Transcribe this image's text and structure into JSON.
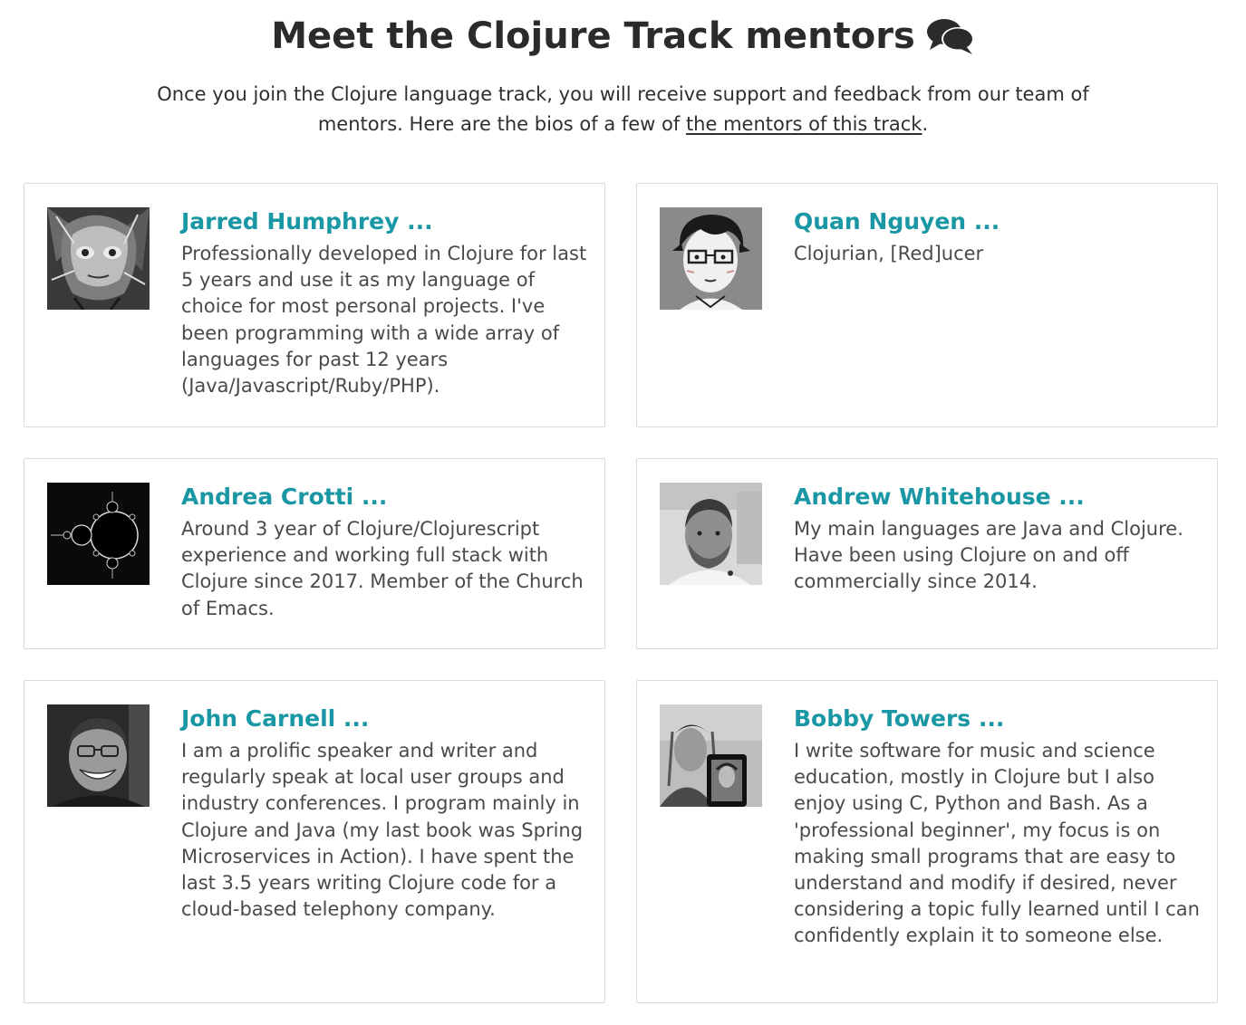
{
  "header": {
    "title": "Meet the Clojure Track mentors",
    "title_icon": "comments-icon",
    "intro_text": "Once you join the Clojure language track, you will receive support and feedback from our team of mentors. Here are the bios of a few of ",
    "intro_link": "the mentors of this track",
    "intro_end": "."
  },
  "colors": {
    "accent": "#1a97a4",
    "text": "#4a4a4a",
    "border": "#dadada"
  },
  "mentors": [
    {
      "name": "Jarred Humphrey ...",
      "avatar": "illustrated-face-avatar",
      "bio": "Professionally developed in Clojure for last 5 years and use it as my language of choice for most personal projects. I've been programming with a wide array of languages for past 12 years (Java/Javascript/Ruby/PHP)."
    },
    {
      "name": "Quan Nguyen ...",
      "avatar": "cartoon-glasses-avatar",
      "bio": "Clojurian, [Red]ucer"
    },
    {
      "name": "Andrea Crotti ...",
      "avatar": "mandelbrot-fractal-avatar",
      "bio": "Around 3 year of Clojure/Clojurescript experience and working full stack with Clojure since 2017. Member of the Church of Emacs."
    },
    {
      "name": "Andrew Whitehouse ...",
      "avatar": "bearded-man-photo-avatar",
      "bio": "My main languages are Java and Clojure. Have been using Clojure on and off commercially since 2014."
    },
    {
      "name": "John Carnell ...",
      "avatar": "smiling-man-photo-avatar",
      "bio": "I am a prolific speaker and writer and regularly speak at local user groups and industry conferences. I program mainly in Clojure and Java (my last book was Spring Microservices in Action). I have spent the last 3.5 years writing Clojure code for a cloud-based telephony company."
    },
    {
      "name": "Bobby Towers ...",
      "avatar": "tablet-selfie-photo-avatar",
      "bio": "I write software for music and science education, mostly in Clojure but I also enjoy using C, Python and Bash. As a 'professional beginner', my focus is on making small programs that are easy to understand and modify if desired, never considering a topic fully learned until I can confidently explain it to someone else."
    }
  ]
}
